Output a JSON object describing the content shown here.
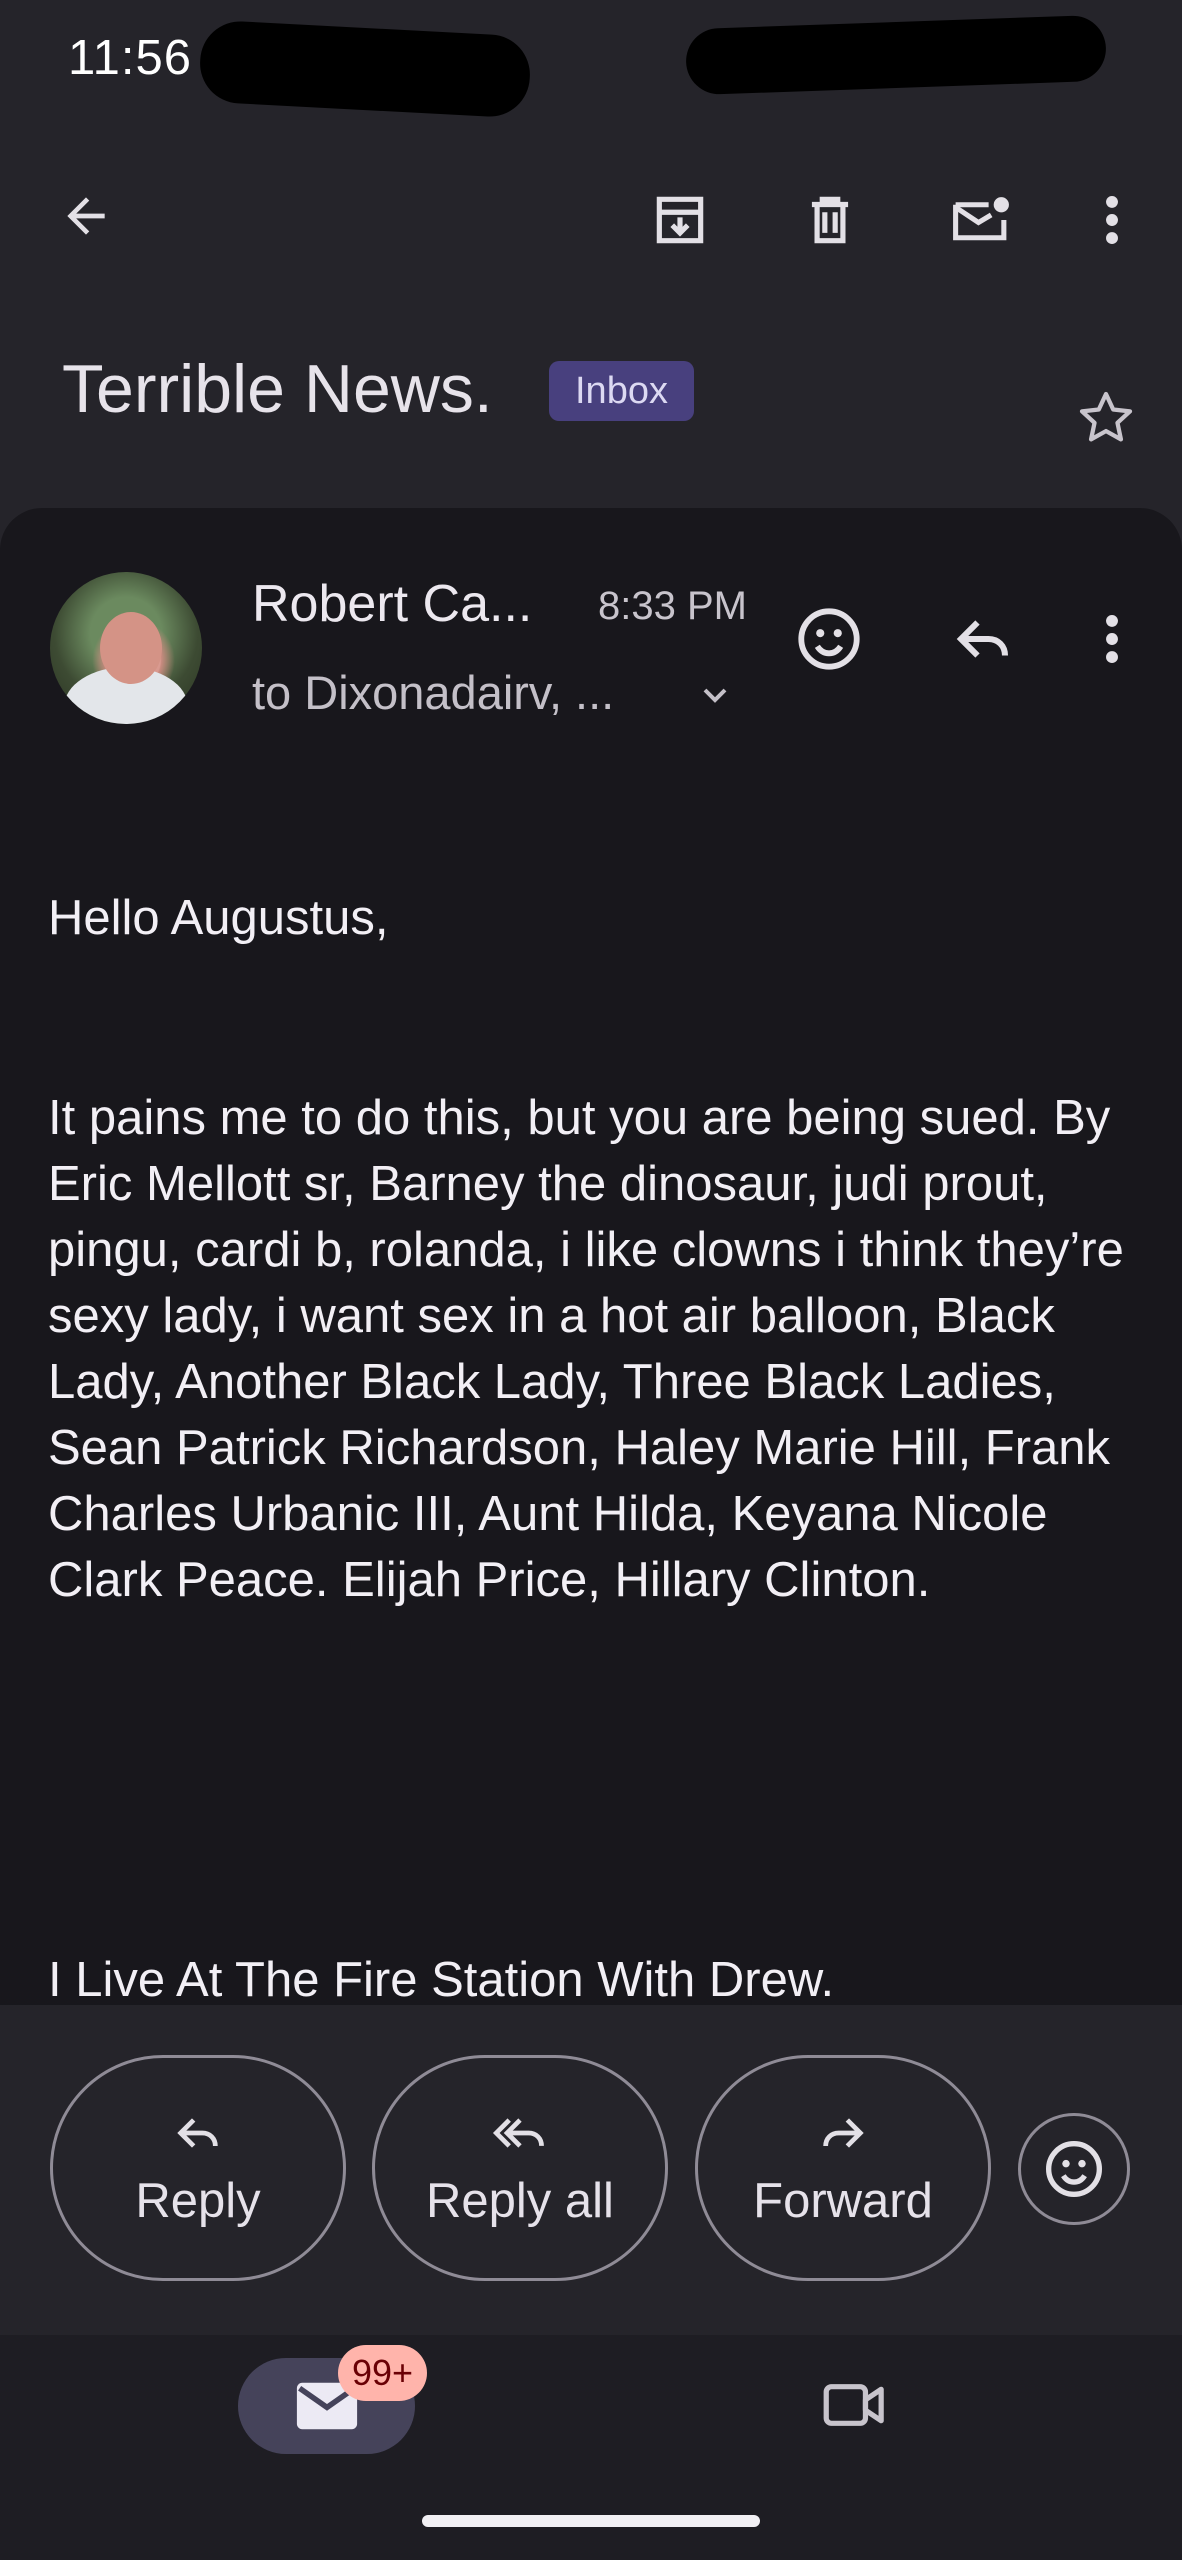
{
  "status_bar": {
    "time": "11:56"
  },
  "toolbar": {
    "back_icon": "arrow-back-icon",
    "archive_icon": "archive-icon",
    "delete_icon": "delete-icon",
    "mark_unread_icon": "mark-unread-icon",
    "more_icon": "more-vert-icon"
  },
  "email": {
    "subject": "Terrible News.",
    "label": "Inbox",
    "sender_name": "Robert Ca...",
    "time": "8:33 PM",
    "recipients": "to Dixonadairv, ...",
    "greeting": "Hello Augustus,",
    "body": "It pains me to do this, but you are being sued. By Eric Mellott sr, Barney the dinosaur, judi prout, pingu, cardi b, rolanda, i like clowns i think they’re sexy lady, i want sex in a hot air balloon, Black Lady, Another Black Lady, Three Black Ladies, Sean Patrick Richardson, Haley Marie Hill, Frank Charles Urbanic III, Aunt Hilda, Keyana Nicole Clark Peace. Elijah Price, Hillary Clinton.",
    "closing": "I Live At The Fire Station With Drew."
  },
  "actions": {
    "reply": "Reply",
    "reply_all": "Reply all",
    "forward": "Forward"
  },
  "nav": {
    "mail_badge": "99+"
  },
  "colors": {
    "background": "#25242a",
    "card": "#18171c",
    "label_chip": "#48407e",
    "badge": "#ffb4ab"
  }
}
